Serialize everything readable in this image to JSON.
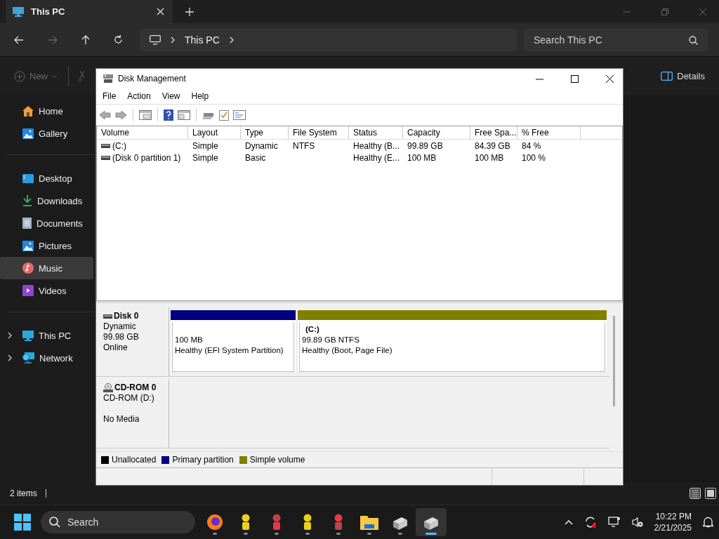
{
  "explorer": {
    "tab": {
      "title": "This PC",
      "selected": true
    },
    "address": {
      "crumbs": [
        "This PC"
      ]
    },
    "search": {
      "placeholder": "Search This PC"
    },
    "commands": [
      {
        "label": "New",
        "disabled": true
      },
      {
        "label": "Details",
        "disabled": false
      }
    ],
    "sidebar": {
      "groups": [
        [
          {
            "label": "Home",
            "kind": "home",
            "selected": false
          },
          {
            "label": "Gallery",
            "kind": "gallery",
            "selected": false
          }
        ],
        [
          {
            "label": "Desktop",
            "kind": "desktop",
            "selected": false
          },
          {
            "label": "Downloads",
            "kind": "download",
            "selected": false
          },
          {
            "label": "Documents",
            "kind": "document",
            "selected": false
          },
          {
            "label": "Pictures",
            "kind": "pictures",
            "selected": false
          },
          {
            "label": "Music",
            "kind": "music",
            "selected": true
          },
          {
            "label": "Videos",
            "kind": "video",
            "selected": false
          }
        ],
        [
          {
            "label": "This PC",
            "kind": "pc",
            "selected": false,
            "expanded": false
          },
          {
            "label": "Network",
            "kind": "network",
            "selected": false,
            "expanded": false
          }
        ]
      ]
    },
    "status_bar": {
      "items": "2 items"
    }
  },
  "disk_management": {
    "title": "Disk Management",
    "menu": [
      "File",
      "Action",
      "View",
      "Help"
    ],
    "table": {
      "columns": [
        "Volume",
        "Layout",
        "Type",
        "File System",
        "Status",
        "Capacity",
        "Free Spa...",
        "% Free"
      ],
      "rows": [
        [
          "(C:)",
          "Simple",
          "Dynamic",
          "NTFS",
          "Healthy (B...",
          "99.89 GB",
          "84.39 GB",
          "84 %"
        ],
        [
          "(Disk 0 partition 1)",
          "Simple",
          "Basic",
          "",
          "Healthy (E...",
          "100 MB",
          "100 MB",
          "100 %"
        ]
      ]
    },
    "disks": [
      {
        "name": "Disk 0",
        "kind": "disk",
        "type": "Dynamic",
        "size": "99.98 GB",
        "status": "Online",
        "partitions": [
          {
            "color": "#000080",
            "size": "100 MB",
            "status": "Healthy (EFI System Partition)"
          },
          {
            "color": "#808000",
            "label": "(C:)",
            "size": "99.89 GB NTFS",
            "status": "Healthy (Boot, Page File)"
          }
        ]
      },
      {
        "name": "CD-ROM 0",
        "kind": "cdrom",
        "type": "CD-ROM (D:)",
        "status": "No Media"
      }
    ],
    "legend": [
      {
        "label": "Unallocated",
        "color": "#000000"
      },
      {
        "label": "Primary partition",
        "color": "#000080"
      },
      {
        "label": "Simple volume",
        "color": "#808000"
      }
    ]
  },
  "taskbar": {
    "search": {
      "placeholder": "Search"
    },
    "apps": [
      {
        "kind": "browser",
        "selected": false
      },
      {
        "kind": "figure",
        "selected": false
      },
      {
        "kind": "figure",
        "selected": false
      },
      {
        "kind": "figure",
        "selected": false
      },
      {
        "kind": "figure",
        "selected": false
      },
      {
        "kind": "folder",
        "selected": false
      },
      {
        "kind": "disk",
        "selected": false
      },
      {
        "kind": "disk",
        "selected": true
      }
    ],
    "time": "10:22 PM",
    "date": "2/21/2025"
  }
}
